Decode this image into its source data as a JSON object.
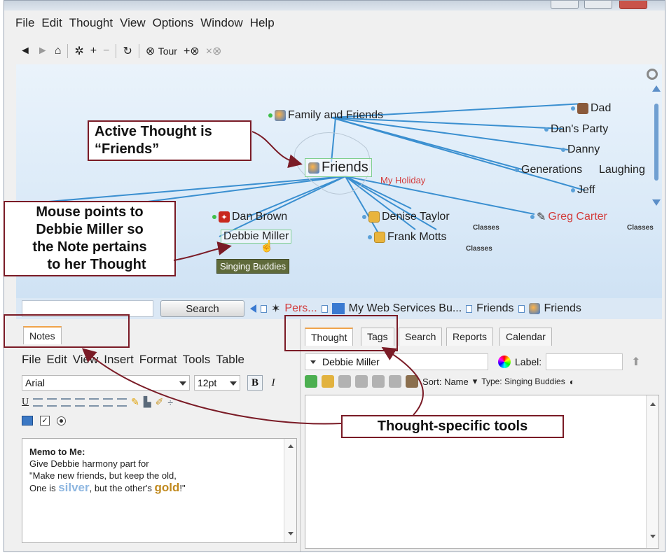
{
  "menu": [
    "File",
    "Edit",
    "Thought",
    "View",
    "Options",
    "Window",
    "Help"
  ],
  "toolbar": {
    "tour_label": "Tour"
  },
  "map": {
    "nodes": {
      "family": "Family and Friends",
      "friends": "Friends",
      "dad": "Dad",
      "dans_party": "Dan's Party",
      "danny": "Danny",
      "generations": "Generations",
      "laughing": "Laughing",
      "jeff": "Jeff",
      "dan_brown": "Dan Brown",
      "debbie": "Debbie Miller",
      "denise": "Denise Taylor",
      "frank": "Frank Motts",
      "greg": "Greg Carter"
    },
    "my_holiday": "My Holiday",
    "classes": "Classes",
    "tooltip": "Singing Buddies"
  },
  "search": {
    "button": "Search"
  },
  "pins": [
    "Pers...",
    "My Web Services Bu...",
    "Friends",
    "Friends"
  ],
  "notes_tab": "Notes",
  "editor": {
    "menu": [
      "File",
      "Edit",
      "View",
      "Insert",
      "Format",
      "Tools",
      "Table"
    ],
    "font": "Arial",
    "size": "12pt",
    "bold": "B",
    "italic": "I",
    "underline": "U"
  },
  "note": {
    "title": "Memo to Me:",
    "line1": "Give Debbie harmony part for",
    "line2": "\"Make new friends, but keep the old,",
    "line3_a": "One is ",
    "silver": "silver",
    "line3_b": ", but the other's ",
    "gold": "gold",
    "line3_c": "!\""
  },
  "right_tabs": [
    "Thought",
    "Tags",
    "Search",
    "Reports",
    "Calendar"
  ],
  "thought": {
    "name": "Debbie Miller",
    "label_text": "Label:",
    "sort_text": "Sort: Name",
    "type_text": "Type: Singing Buddies"
  },
  "callouts": {
    "active": [
      "Active Thought is",
      "“Friends”"
    ],
    "mouse": [
      "Mouse points to",
      "Debbie Miller so",
      "the Note pertains",
      "to her Thought"
    ],
    "tools": "Thought-specific tools"
  },
  "colors": {
    "callout_border": "#7a1b26",
    "map_bg": "#dbeaf8",
    "link": "#3a8fd0",
    "accent_red": "#d33b3b"
  }
}
